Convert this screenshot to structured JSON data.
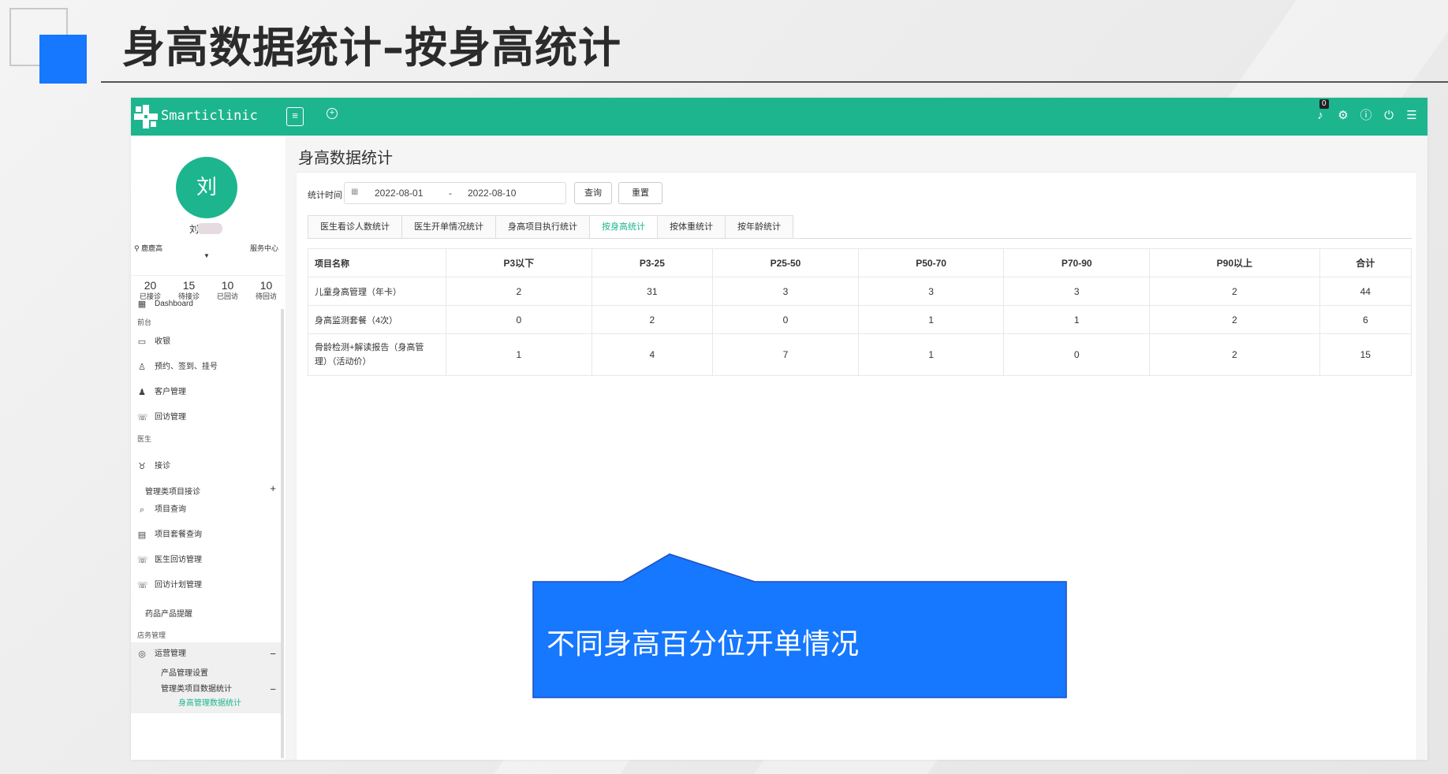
{
  "slide": {
    "title": "身高数据统计–按身高统计",
    "accent_color": "#1677ff"
  },
  "topbar": {
    "brand": "Smarticlinic",
    "color": "#1db58e",
    "notification_count": "0",
    "icons": [
      "bell-icon",
      "gear-icon",
      "help-icon",
      "power-icon",
      "list-icon"
    ]
  },
  "sidebar": {
    "avatar_initial": "刘",
    "user_name": "刘",
    "location": "鹿鹿高",
    "service_center": "服务中心",
    "stats": [
      {
        "value": "20",
        "label": "已接诊"
      },
      {
        "value": "15",
        "label": "待接诊"
      },
      {
        "value": "10",
        "label": "已回访"
      },
      {
        "value": "10",
        "label": "待回访"
      }
    ],
    "items": {
      "dashboard": "Dashboard",
      "section_front": "前台",
      "cashier": "收银",
      "appointment": "预约、签到、挂号",
      "customer": "客户管理",
      "followup": "回访管理",
      "section_doctor": "医生",
      "consultation": "接诊",
      "mgmt_item_consult": "管理类项目接诊",
      "item_query": "项目查询",
      "package_query": "项目套餐查询",
      "doctor_followup": "医生回访管理",
      "followup_plan": "回访计划管理",
      "drug_reminder": "药品产品提醒",
      "section_store": "店务管理",
      "operations": "运营管理",
      "product_settings": "产品管理设置",
      "mgmt_item_stats": "管理类项目数据统计",
      "height_stats": "身高管理数据统计"
    }
  },
  "main": {
    "page_title": "身高数据统计",
    "filter": {
      "label": "统计时间",
      "start_date": "2022-08-01",
      "separator": "-",
      "end_date": "2022-08-10",
      "query_button": "查询",
      "reset_button": "重置"
    },
    "tabs": [
      {
        "label": "医生看诊人数统计",
        "active": false
      },
      {
        "label": "医生开单情况统计",
        "active": false
      },
      {
        "label": "身高项目执行统计",
        "active": false
      },
      {
        "label": "按身高统计",
        "active": true
      },
      {
        "label": "按体重统计",
        "active": false
      },
      {
        "label": "按年龄统计",
        "active": false
      }
    ],
    "table": {
      "headers": [
        "项目名称",
        "P3以下",
        "P3-25",
        "P25-50",
        "P50-70",
        "P70-90",
        "P90以上",
        "合计"
      ],
      "rows": [
        [
          "儿童身高管理（年卡）",
          "2",
          "31",
          "3",
          "3",
          "3",
          "2",
          "44"
        ],
        [
          "身高监测套餐（4次）",
          "0",
          "2",
          "0",
          "1",
          "1",
          "2",
          "6"
        ],
        [
          "骨龄检测+解读报告（身高管理）（活动价）",
          "1",
          "4",
          "7",
          "1",
          "0",
          "2",
          "15"
        ]
      ]
    }
  },
  "callout": {
    "text": "不同身高百分位开单情况",
    "color": "#1677ff"
  }
}
